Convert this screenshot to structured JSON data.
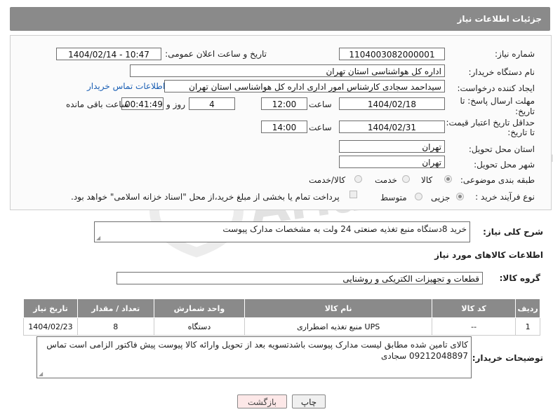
{
  "header": {
    "title": "جزئیات اطلاعات نیاز"
  },
  "form": {
    "need_number": {
      "label": "شماره نیاز:",
      "value": "1104003082000001"
    },
    "announce": {
      "label": "تاریخ و ساعت اعلان عمومی:",
      "value": "1404/02/14 - 10:47"
    },
    "buyer_org": {
      "label": "نام دستگاه خریدار:",
      "value": "اداره کل هواشناسی استان تهران"
    },
    "requester": {
      "label": "ایجاد کننده درخواست:",
      "value": "سیداحمد سجادی کارشناس امور اداری اداره کل هواشناسی استان تهران",
      "contact_link": "اطلاعات تماس خریدار"
    },
    "deadline": {
      "label_line1": "مهلت ارسال پاسخ: تا",
      "label_line2": "تاریخ:",
      "date": "1404/02/18",
      "time_label": "ساعت",
      "time": "12:00",
      "days": "4",
      "days_label": "روز و",
      "remaining": "00:41:49",
      "remaining_label": "ساعت باقی مانده"
    },
    "price_validity": {
      "label_line1": "حداقل تاریخ اعتبار قیمت:",
      "label_line2": "تا تاریخ:",
      "date": "1404/02/31",
      "time_label": "ساعت",
      "time": "14:00"
    },
    "province": {
      "label": "استان محل تحویل:",
      "value": "تهران"
    },
    "city": {
      "label": "شهر محل تحویل:",
      "value": "تهران"
    },
    "category": {
      "label": "طبقه بندی موضوعی:",
      "options": [
        "کالا",
        "خدمت",
        "کالا/خدمت"
      ],
      "selected": "کالا"
    },
    "process": {
      "label": "نوع فرآیند خرید :",
      "options": [
        "جزیی",
        "متوسط"
      ],
      "selected": "جزیی",
      "payment_note": "پرداخت تمام یا بخشی از مبلغ خرید،از محل \"اسناد خزانه اسلامی\" خواهد بود."
    }
  },
  "description": {
    "label": "شرح کلی نیاز:",
    "value": "خرید 8دستگاه منبع تغذیه صنعتی 24 ولت به مشخصات مدارک پیوست"
  },
  "goods_section": {
    "title": "اطلاعات کالاهای مورد نیاز"
  },
  "goods_group": {
    "label": "گروه کالا:",
    "value": "قطعات و تجهیزات الکتریکی و روشنایی"
  },
  "table": {
    "columns": [
      "ردیف",
      "کد کالا",
      "نام کالا",
      "واحد شمارش",
      "تعداد / مقدار",
      "تاریخ نیاز"
    ],
    "rows": [
      [
        "1",
        "--",
        "منبع تغذیه اضطراری UPS",
        "دستگاه",
        "8",
        "1404/02/23"
      ]
    ]
  },
  "buyer_notes": {
    "label": "توضیحات خریدار:",
    "line1": "کالای تامین شده مطابق لیست مدارک پیوست باشدتسویه بعد از تحویل وارائه کالا پیوست پیش فاکتور الزامی است  تماس",
    "line2": "09212048897 سجادی"
  },
  "buttons": {
    "print": "چاپ",
    "back": "بازگشت"
  },
  "watermark": {
    "text": "AriaTender.net"
  }
}
